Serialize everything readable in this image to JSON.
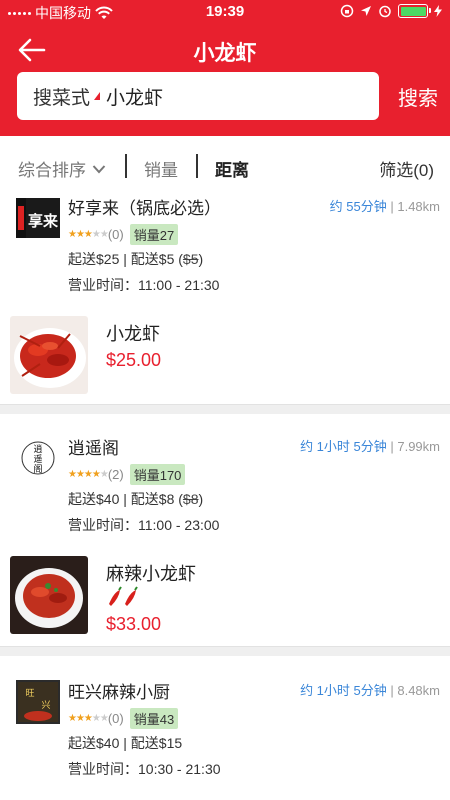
{
  "status_bar": {
    "carrier": "中国移动",
    "time": "19:39",
    "battery_color": "#4cd964"
  },
  "nav": {
    "title": "小龙虾",
    "back_icon": "arrow-left-icon"
  },
  "search": {
    "prefix": "搜菜式",
    "query": "小龙虾",
    "button": "搜索"
  },
  "filters": {
    "sort": "综合排序",
    "sales": "销量",
    "distance": "距离",
    "filter": "筛选(0)"
  },
  "shops": [
    {
      "name": "好享来（锅底必选）",
      "logo_text": "好享来",
      "eta": "约 55分钟",
      "distance": "1.48km",
      "stars": 3,
      "reviews": "(0)",
      "sales": "销量27",
      "min_order": "起送$25",
      "delivery": "配送$5",
      "delivery_old": "$5",
      "hours_label": "营业时间：",
      "hours": "11:00 - 21:30",
      "dish": {
        "name": "小龙虾",
        "price": "$25.00",
        "spicy": 0
      }
    },
    {
      "name": "逍遥阁",
      "logo_text": "逍遥阁",
      "eta": "约 1小时 5分钟",
      "distance": "7.99km",
      "stars": 4,
      "reviews": "(2)",
      "sales": "销量170",
      "min_order": "起送$40",
      "delivery": "配送$8",
      "delivery_old": "$8",
      "hours_label": "营业时间：",
      "hours": "11:00 - 23:00",
      "dish": {
        "name": "麻辣小龙虾",
        "price": "$33.00",
        "spicy": 2
      }
    },
    {
      "name": "旺兴麻辣小厨",
      "logo_text": "旺兴",
      "eta": "约 1小时 5分钟",
      "distance": "8.48km",
      "stars": 3,
      "reviews": "(0)",
      "sales": "销量43",
      "min_order": "起送$40",
      "delivery": "配送$15",
      "hours_label": "营业时间：",
      "hours": "10:30 - 21:30"
    }
  ],
  "colors": {
    "brand": "#e8202e",
    "eta": "#3a86d8",
    "badge": "#c9e8c0",
    "star": "#f0a01e"
  }
}
